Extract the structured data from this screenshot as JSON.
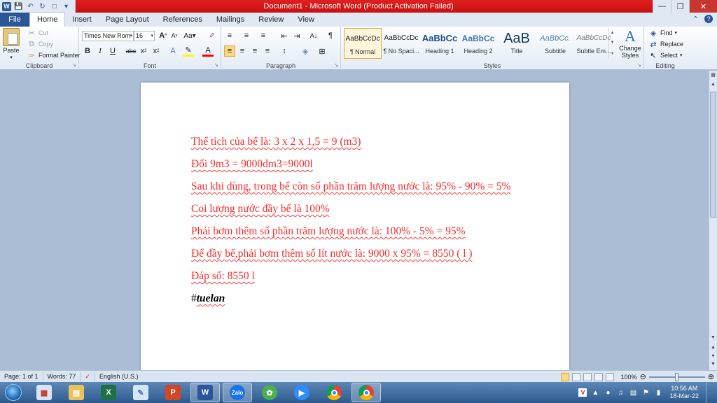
{
  "window": {
    "title": "Document1  -  Microsoft Word (Product Activation Failed)"
  },
  "tabs": {
    "file": "File",
    "items": [
      "Home",
      "Insert",
      "Page Layout",
      "References",
      "Mailings",
      "Review",
      "View"
    ]
  },
  "clipboard": {
    "paste": "Paste",
    "cut": "Cut",
    "copy": "Copy",
    "format_painter": "Format Painter",
    "label": "Clipboard"
  },
  "font": {
    "name": "Times New Rom",
    "size": "16",
    "label": "Font"
  },
  "paragraph": {
    "label": "Paragraph"
  },
  "styles": {
    "label": "Styles",
    "items": [
      {
        "sample": "AaBbCcDc",
        "name": "¶ Normal"
      },
      {
        "sample": "AaBbCcDc",
        "name": "¶ No Spaci..."
      },
      {
        "sample": "AaBbCc",
        "name": "Heading 1"
      },
      {
        "sample": "AaBbCc",
        "name": "Heading 2"
      },
      {
        "sample": "AaB",
        "name": "Title"
      },
      {
        "sample": "AaBbCc.",
        "name": "Subtitle"
      },
      {
        "sample": "AaBbCcDc",
        "name": "Subtle Em..."
      }
    ],
    "change_styles": "Change Styles"
  },
  "editing": {
    "find": "Find",
    "replace": "Replace",
    "select": "Select",
    "label": "Editing"
  },
  "document": {
    "lines": [
      "Thể tích của bể là: 3 x 2 x 1,5 = 9 (m3)",
      "Đổi 9m3 = 9000dm3=9000l",
      "Sau khi dùng, trong bể còn số phần trăm lượng nước là: 95% - 90% = 5%",
      "Coi lượng nước đầy bể là 100%",
      "Phải bơm thêm số phần trăm lượng nước là: 100% - 5% = 95%",
      "Để đầy bể,phải bơm thêm số lít nước là: 9000 x 95% = 8550 ( l )",
      "Đáp số: 8550 l"
    ],
    "tag_prefix": "#",
    "tag_word": "tuelan"
  },
  "status": {
    "page": "Page: 1 of 1",
    "words": "Words: 77",
    "language": "English (U.S.)",
    "zoom": "100%"
  },
  "taskbar": {
    "apps": [
      "word-app-icon",
      "zalo-app-icon"
    ],
    "zalo_label": "Zalo",
    "time": "10:56 AM",
    "date": "18-Mar-22"
  }
}
